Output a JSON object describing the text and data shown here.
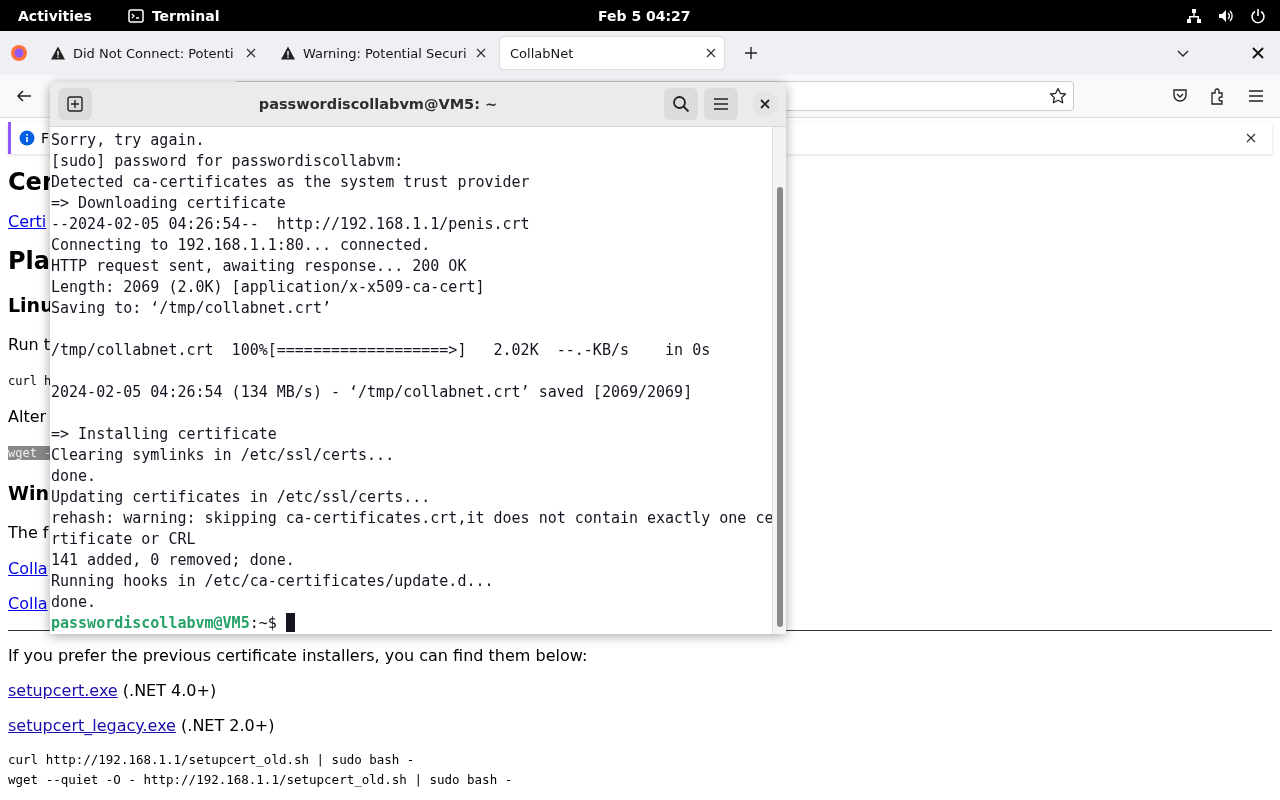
{
  "top_bar": {
    "activities": "Activities",
    "app": "Terminal",
    "clock": "Feb 5  04:27"
  },
  "browser": {
    "tabs": [
      {
        "title": "Did Not Connect: Potenti",
        "warning": true,
        "selected": false
      },
      {
        "title": "Warning: Potential Securi",
        "warning": true,
        "selected": false
      },
      {
        "title": "CollabNet",
        "warning": false,
        "selected": true
      }
    ],
    "notification": {
      "text": "F"
    },
    "page_left": [
      {
        "kind": "heading1",
        "text": "Cer"
      },
      {
        "kind": "link",
        "text": "Certi"
      },
      {
        "kind": "heading1",
        "text": "Pla"
      },
      {
        "kind": "heading2",
        "text": "Linu"
      },
      {
        "kind": "text",
        "text": "Run t"
      },
      {
        "kind": "code",
        "text": "curl h"
      },
      {
        "kind": "text",
        "text": "Alter"
      },
      {
        "kind": "code_highlight",
        "text": "wget -"
      },
      {
        "kind": "heading2",
        "text": "Win"
      },
      {
        "kind": "text",
        "text": "The f"
      },
      {
        "kind": "link",
        "text": "Colla"
      },
      {
        "kind": "link",
        "text": "Colla"
      }
    ],
    "page_bottom": [
      {
        "kind": "text",
        "text": "If you prefer the previous certificate installers, you can find them below:"
      },
      {
        "kind": "link_note",
        "link": "setupcert.exe",
        "note": "(.NET 4.0+)"
      },
      {
        "kind": "link_note",
        "link": "setupcert_legacy.exe",
        "note": "(.NET 2.0+)"
      },
      {
        "kind": "code",
        "text": "curl http://192.168.1.1/setupcert_old.sh | sudo bash -"
      },
      {
        "kind": "code",
        "text": "wget --quiet -O - http://192.168.1.1/setupcert_old.sh | sudo bash -"
      }
    ]
  },
  "terminal": {
    "title": "passwordiscollabvm@VM5: ~",
    "lines": [
      {
        "kind": "output",
        "text": "Sorry, try again."
      },
      {
        "kind": "output",
        "text": "[sudo] password for passwordiscollabvm:"
      },
      {
        "kind": "output",
        "text": "Detected ca-certificates as the system trust provider"
      },
      {
        "kind": "output",
        "text": "=> Downloading certificate"
      },
      {
        "kind": "output",
        "text": "--2024-02-05 04:26:54--  http://192.168.1.1/penis.crt"
      },
      {
        "kind": "output",
        "text": "Connecting to 192.168.1.1:80... connected."
      },
      {
        "kind": "output",
        "text": "HTTP request sent, awaiting response... 200 OK"
      },
      {
        "kind": "output",
        "text": "Length: 2069 (2.0K) [application/x-x509-ca-cert]"
      },
      {
        "kind": "output",
        "text": "Saving to: ‘/tmp/collabnet.crt’"
      },
      {
        "kind": "blank"
      },
      {
        "kind": "output",
        "text": "/tmp/collabnet.crt  100%[===================>]   2.02K  --.-KB/s    in 0s"
      },
      {
        "kind": "blank"
      },
      {
        "kind": "output",
        "text": "2024-02-05 04:26:54 (134 MB/s) - ‘/tmp/collabnet.crt’ saved [2069/2069]"
      },
      {
        "kind": "blank"
      },
      {
        "kind": "output",
        "text": "=> Installing certificate"
      },
      {
        "kind": "output",
        "text": "Clearing symlinks in /etc/ssl/certs..."
      },
      {
        "kind": "output",
        "text": "done."
      },
      {
        "kind": "output",
        "text": "Updating certificates in /etc/ssl/certs..."
      },
      {
        "kind": "output",
        "text": "rehash: warning: skipping ca-certificates.crt,it does not contain exactly one ce"
      },
      {
        "kind": "output",
        "text": "rtificate or CRL"
      },
      {
        "kind": "output",
        "text": "141 added, 0 removed; done."
      },
      {
        "kind": "output",
        "text": "Running hooks in /etc/ca-certificates/update.d..."
      },
      {
        "kind": "output",
        "text": "done."
      }
    ],
    "prompt": {
      "user": "passwordiscollabvm@VM5",
      "path": ":~$"
    }
  }
}
